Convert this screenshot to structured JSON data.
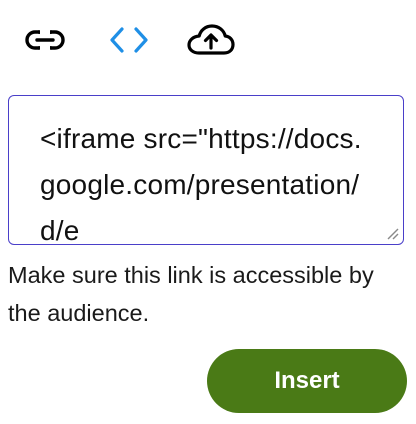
{
  "toolbar": {
    "tools": [
      {
        "icon": "link-icon",
        "active": false
      },
      {
        "icon": "code-icon",
        "active": true
      },
      {
        "icon": "cloud-upload-icon",
        "active": false
      }
    ],
    "active_color": "#1f8fe6"
  },
  "embed": {
    "value": "<iframe src=\"https://docs.google.com/presentation/d/e"
  },
  "hint": {
    "text": "Make sure this link is accessible by the audience."
  },
  "actions": {
    "insert_label": "Insert",
    "insert_color": "#4a7a16"
  }
}
